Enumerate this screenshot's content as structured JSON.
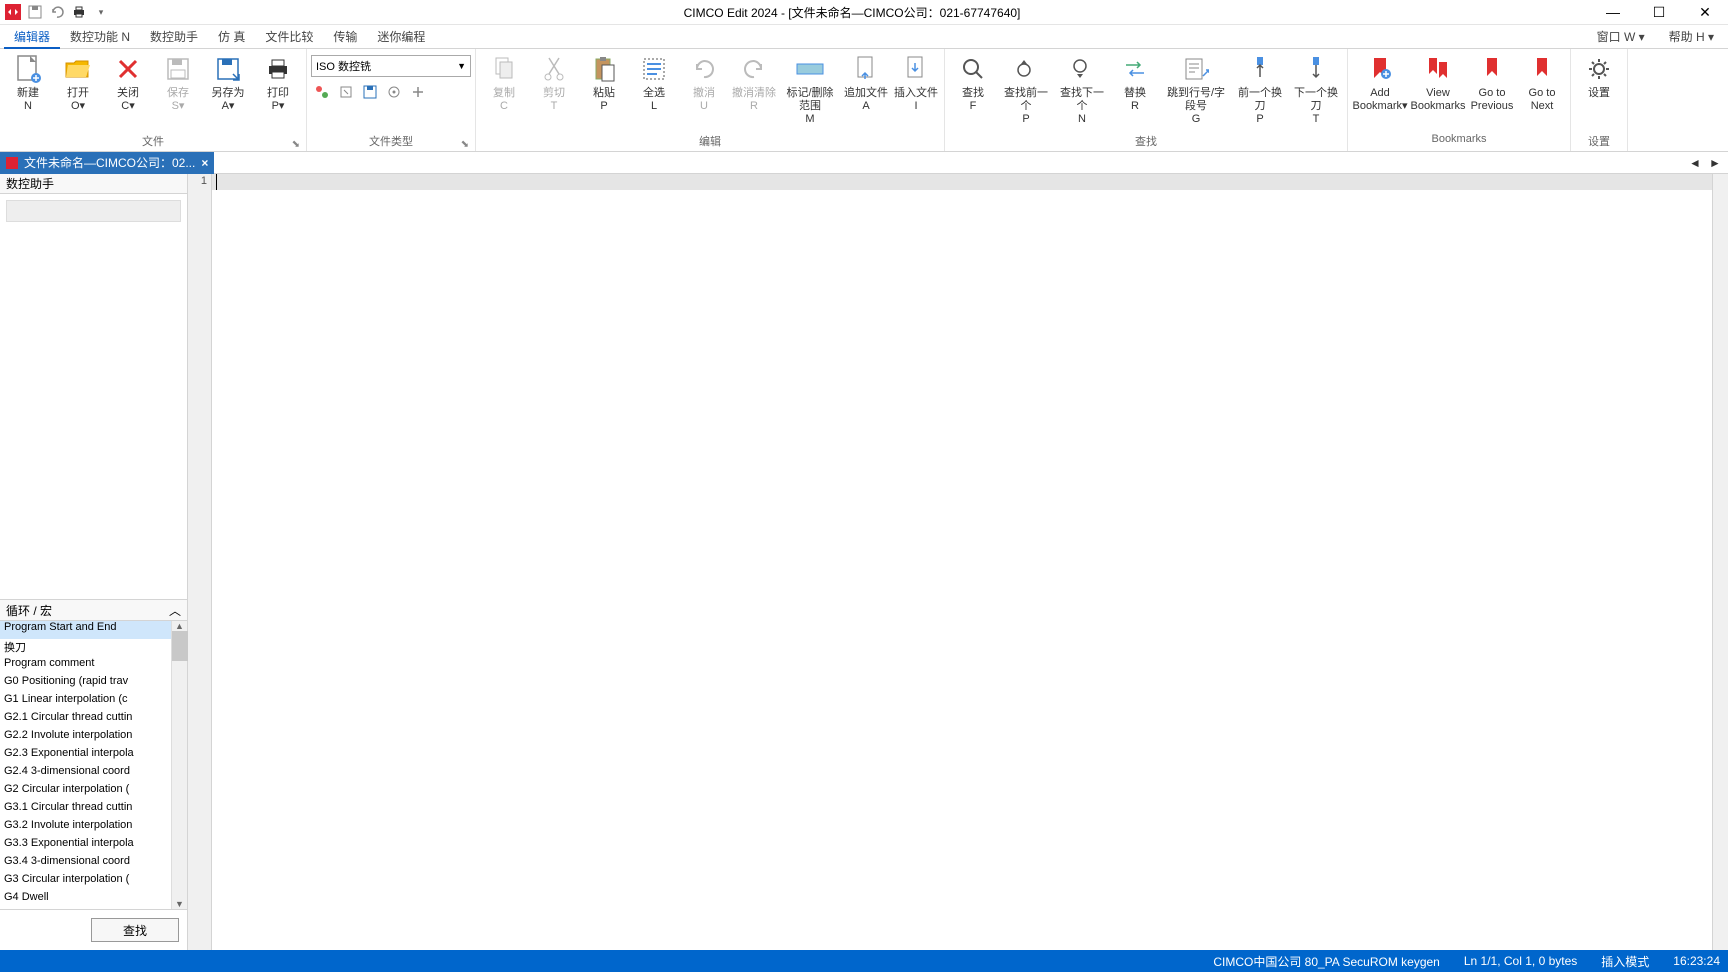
{
  "title": "CIMCO Edit 2024 - [文件未命名—CIMCO公司：021-67747640]",
  "menutabs": [
    "编辑器",
    "数控功能 N",
    "数控助手",
    "仿  真",
    "文件比较",
    "传输",
    "迷你编程"
  ],
  "menutabs_right": [
    "窗口 W ▾",
    "帮助 H ▾"
  ],
  "ribbon": {
    "file": {
      "title": "文件",
      "items": [
        {
          "label1": "新建",
          "label2": "N"
        },
        {
          "label1": "打开",
          "label2": "O▾"
        },
        {
          "label1": "关闭",
          "label2": "C▾"
        },
        {
          "label1": "保存",
          "label2": "S▾"
        },
        {
          "label1": "另存为",
          "label2": "A▾"
        },
        {
          "label1": "打印",
          "label2": "P▾"
        }
      ]
    },
    "filetype": {
      "title": "文件类型",
      "selected": "ISO 数控铣"
    },
    "edit": {
      "title": "编辑",
      "items": [
        {
          "label1": "复制",
          "label2": "C"
        },
        {
          "label1": "剪切",
          "label2": "T"
        },
        {
          "label1": "粘贴",
          "label2": "P"
        },
        {
          "label1": "全选",
          "label2": "L"
        },
        {
          "label1": "撤消",
          "label2": "U"
        },
        {
          "label1": "撤消清除",
          "label2": "R"
        },
        {
          "label1": "标记/删除范围",
          "label2": "M"
        },
        {
          "label1": "追加文件",
          "label2": "A"
        },
        {
          "label1": "插入文件",
          "label2": "I"
        }
      ]
    },
    "find": {
      "title": "查找",
      "items": [
        {
          "label1": "查找",
          "label2": "F"
        },
        {
          "label1": "查找前一个",
          "label2": "P"
        },
        {
          "label1": "查找下一个",
          "label2": "N"
        },
        {
          "label1": "替换",
          "label2": "R"
        },
        {
          "label1": "跳到行号/字段号",
          "label2": "G"
        },
        {
          "label1": "前一个换刀",
          "label2": "P"
        },
        {
          "label1": "下一个换刀",
          "label2": "T"
        }
      ]
    },
    "bookmarks": {
      "title": "Bookmarks",
      "items": [
        {
          "label1": "Add",
          "label2": "Bookmark▾"
        },
        {
          "label1": "View",
          "label2": "Bookmarks"
        },
        {
          "label1": "Go to",
          "label2": "Previous"
        },
        {
          "label1": "Go to",
          "label2": "Next"
        }
      ]
    },
    "settings": {
      "title": "设置",
      "label": "设置"
    }
  },
  "doc_tab": "文件未命名—CIMCO公司：02...",
  "gutter_line": "1",
  "side": {
    "header": "数控助手",
    "section": "循环 / 宏",
    "macros": [
      "Program Start and End",
      "换刀",
      "Program comment",
      "G0 Positioning (rapid trav",
      "G1 Linear interpolation (c",
      "G2.1 Circular thread cuttin",
      "G2.2 Involute interpolation",
      "G2.3 Exponential interpola",
      "G2.4 3-dimensional coord",
      "G2 Circular interpolation (",
      "G3.1 Circular thread cuttin",
      "G3.2 Involute interpolation",
      "G3.3 Exponential interpola",
      "G3.4 3-dimensional coord",
      "G3 Circular interpolation (",
      "G4 Dwell"
    ],
    "search_btn": "查找"
  },
  "status": {
    "left": "CIMCO中国公司 80_PA SecuROM keygen",
    "pos": "Ln 1/1, Col 1, 0 bytes",
    "mode": "插入模式",
    "time": "16:23:24"
  }
}
